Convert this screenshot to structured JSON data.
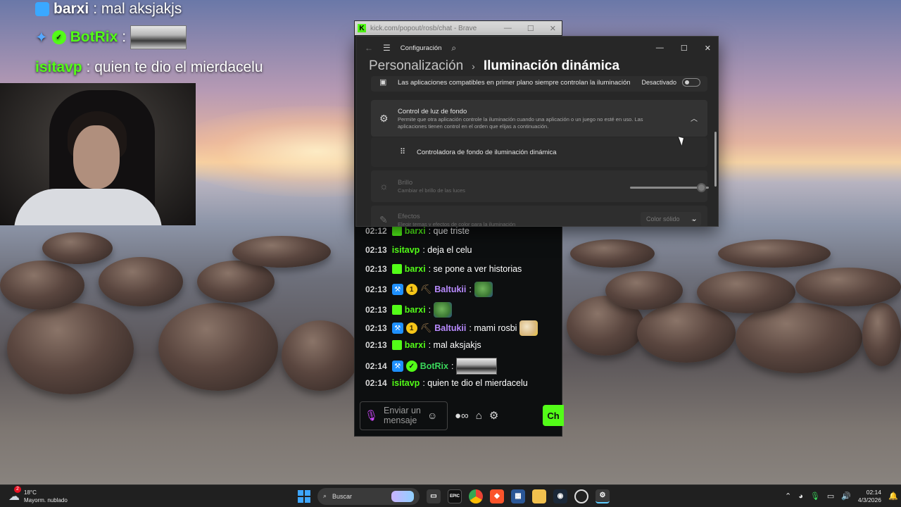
{
  "overlay": {
    "lines": [
      {
        "user": "barxi",
        "text": ": mal aksjakjs"
      },
      {
        "user": "BotRix",
        "text": ":"
      },
      {
        "user": "isitavp",
        "text": ": quien te dio el mierdacelu"
      }
    ]
  },
  "chat_window": {
    "url": "kick.com/popout/rosb/chat - Brave",
    "logo": "K",
    "messages": [
      {
        "time": "02:12",
        "user": "barxi",
        "text": ": que triste"
      },
      {
        "time": "02:13",
        "user": "isitavp",
        "text": ": deja el celu"
      },
      {
        "time": "02:13",
        "user": "barxi",
        "text": ": se pone a ver historias"
      },
      {
        "time": "02:13",
        "user": "Baltukii",
        "text": ":",
        "badge_count": "1"
      },
      {
        "time": "02:13",
        "user": "barxi",
        "text": ":"
      },
      {
        "time": "02:13",
        "user": "Baltukii",
        "text": ": mami rosbi",
        "badge_count": "1"
      },
      {
        "time": "02:13",
        "user": "barxi",
        "text": ": mal aksjakjs"
      },
      {
        "time": "02:14",
        "user": "BotRix",
        "text": ":"
      },
      {
        "time": "02:14",
        "user": "isitavp",
        "text": ": quien te dio el mierdacelu"
      }
    ],
    "input_placeholder": "Enviar un mensaje",
    "send_label": "Ch"
  },
  "settings": {
    "app_title": "Configuración",
    "breadcrumb_parent": "Personalización",
    "breadcrumb_current": "Iluminación dinámica",
    "row_foreground_text": "Las aplicaciones compatibles en primer plano siempre controlan la iluminación",
    "row_foreground_state": "Desactivado",
    "bg_control_title": "Control de luz de fondo",
    "bg_control_desc": "Permite que otra aplicación controle la iluminación cuando una aplicación o un juego no esté en uso. Las aplicaciones tienen control en el orden que elijas a continuación.",
    "controller_item": "Controladora de fondo de iluminación dinámica",
    "brightness_title": "Brillo",
    "brightness_desc": "Cambiar el brillo de las luces",
    "brightness_level": 0.9,
    "effects_title": "Efectos",
    "effects_desc": "Elegir temas y efectos de color para la iluminación",
    "effects_value": "Color sólido"
  },
  "taskbar": {
    "weather_temp": "18°C",
    "weather_desc": "Mayorm. nublado",
    "weather_alert": "2",
    "search_placeholder": "Buscar",
    "epic_label": "EPIC",
    "time": "02:14",
    "date": "4/3/2026"
  },
  "colors": {
    "kick_green": "#53fc18",
    "chat_bg": "#0d0f10",
    "settings_bg": "#272727",
    "taskbar_bg": "#202020"
  }
}
